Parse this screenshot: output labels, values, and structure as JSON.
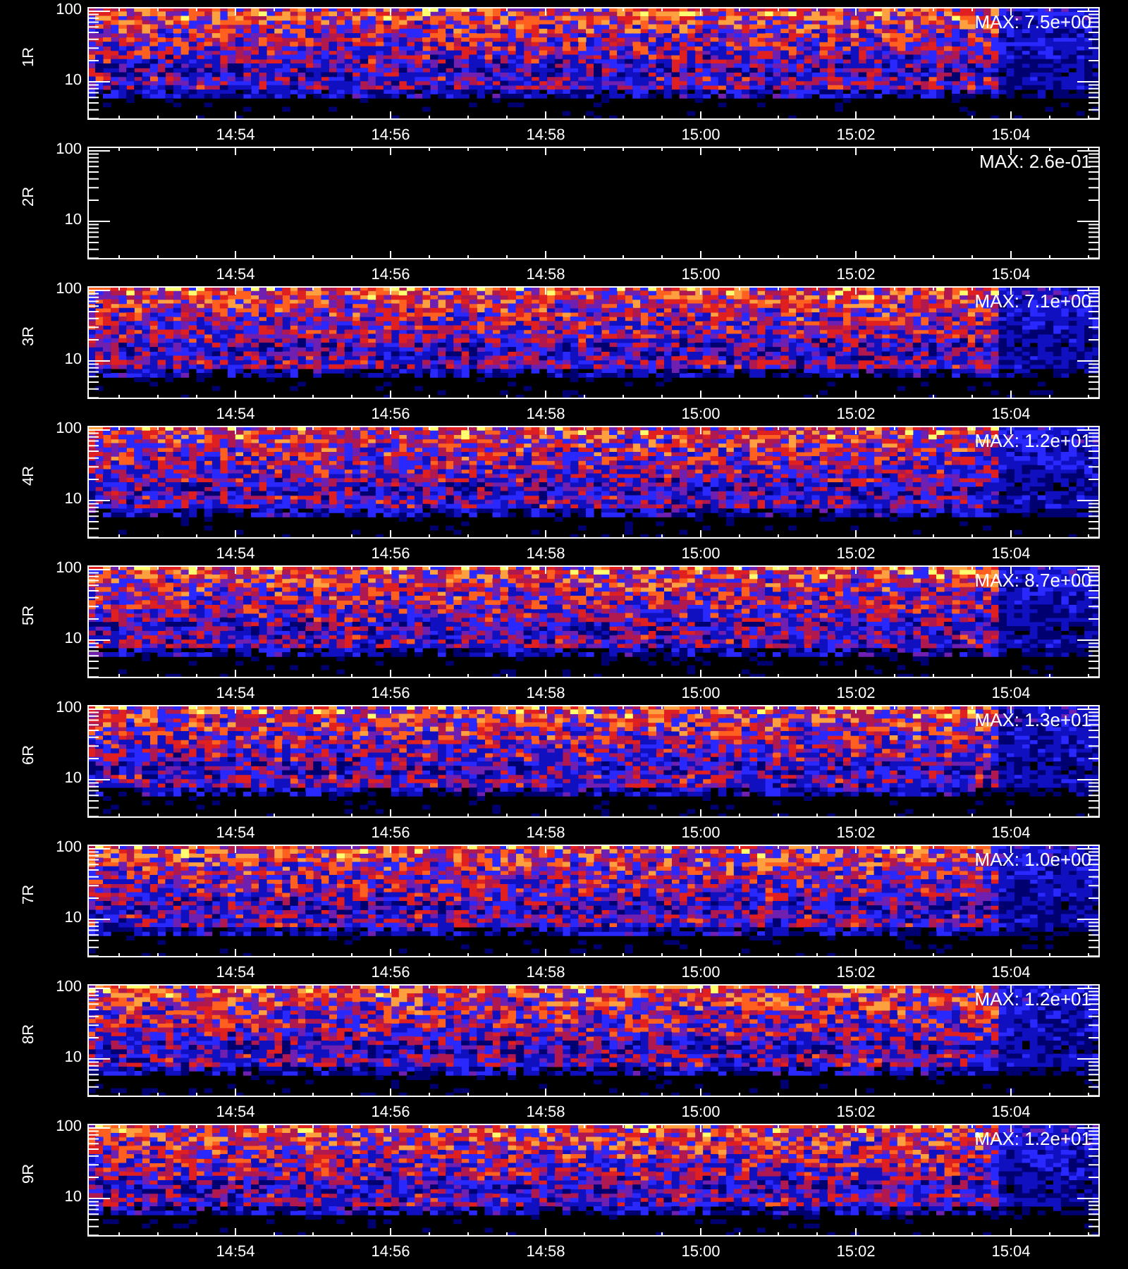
{
  "panels": [
    {
      "label": "1R",
      "kind": "heatmap",
      "max": "MAX: 7.5e+00",
      "yticks": [
        "100",
        "10"
      ],
      "xticks": [
        "14:54",
        "14:56",
        "14:58",
        "15:00",
        "15:02",
        "15:04"
      ]
    },
    {
      "label": "2R",
      "kind": "blank",
      "max": "MAX: 2.6e-01",
      "yticks": [
        "100",
        "10"
      ],
      "xticks": [
        "14:54",
        "14:56",
        "14:58",
        "15:00",
        "15:02",
        "15:04"
      ]
    },
    {
      "label": "3R",
      "kind": "heatmap",
      "max": "MAX: 7.1e+00",
      "yticks": [
        "100",
        "10"
      ],
      "xticks": [
        "14:54",
        "14:56",
        "14:58",
        "15:00",
        "15:02",
        "15:04"
      ]
    },
    {
      "label": "4R",
      "kind": "heatmap",
      "max": "MAX: 1.2e+01",
      "yticks": [
        "100",
        "10"
      ],
      "xticks": [
        "14:54",
        "14:56",
        "14:58",
        "15:00",
        "15:02",
        "15:04"
      ]
    },
    {
      "label": "5R",
      "kind": "heatmap",
      "max": "MAX: 8.7e+00",
      "yticks": [
        "100",
        "10"
      ],
      "xticks": [
        "14:54",
        "14:56",
        "14:58",
        "15:00",
        "15:02",
        "15:04"
      ]
    },
    {
      "label": "6R",
      "kind": "heatmap",
      "max": "MAX: 1.3e+01",
      "yticks": [
        "100",
        "10"
      ],
      "xticks": [
        "14:54",
        "14:56",
        "14:58",
        "15:00",
        "15:02",
        "15:04"
      ]
    },
    {
      "label": "7R",
      "kind": "heatmap",
      "max": "MAX: 1.0e+00",
      "yticks": [
        "100",
        "10"
      ],
      "xticks": [
        "14:54",
        "14:56",
        "14:58",
        "15:00",
        "15:02",
        "15:04"
      ]
    },
    {
      "label": "8R",
      "kind": "heatmap",
      "max": "MAX: 1.2e+01",
      "yticks": [
        "100",
        "10"
      ],
      "xticks": [
        "14:54",
        "14:56",
        "14:58",
        "15:00",
        "15:02",
        "15:04"
      ]
    },
    {
      "label": "9R",
      "kind": "heatmap",
      "max": "MAX: 1.2e+01",
      "yticks": [
        "100",
        "10"
      ],
      "xticks": [
        "14:54",
        "14:56",
        "14:58",
        "15:00",
        "15:02",
        "15:04"
      ]
    }
  ]
}
